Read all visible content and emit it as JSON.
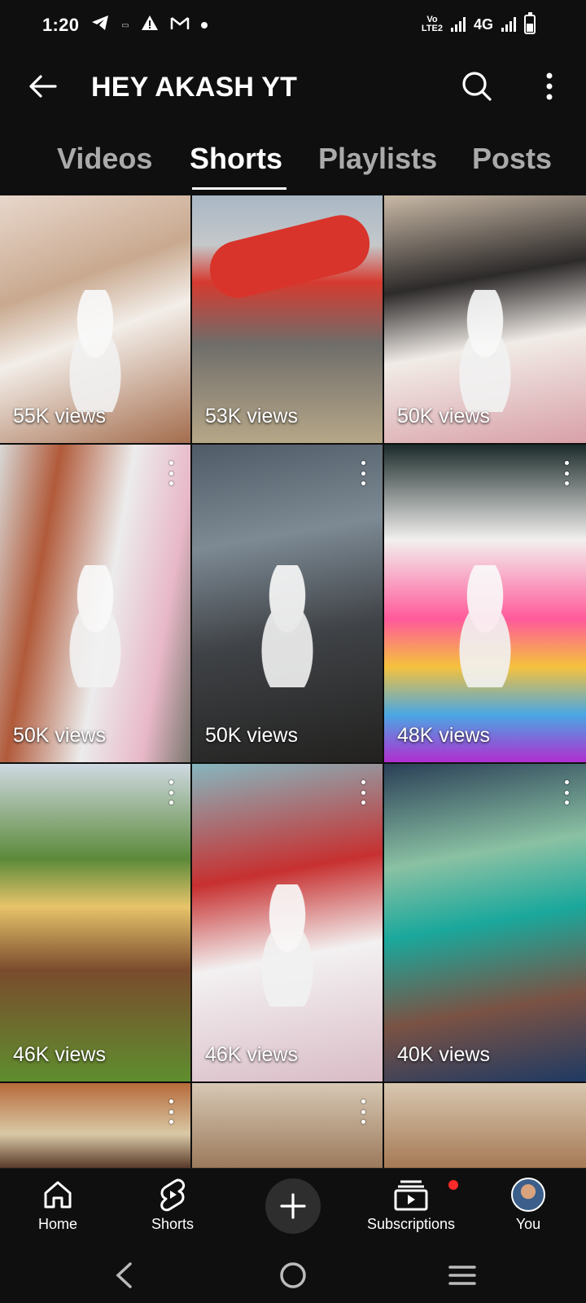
{
  "status_bar": {
    "time": "1:20",
    "network_label": "4G"
  },
  "header": {
    "channel_name": "HEY AKASH YT"
  },
  "tabs": [
    {
      "label": "Videos",
      "active": false
    },
    {
      "label": "Shorts",
      "active": true
    },
    {
      "label": "Playlists",
      "active": false
    },
    {
      "label": "Posts",
      "active": false
    }
  ],
  "shorts": [
    {
      "views": "55K views",
      "bg": "linear-gradient(160deg,#e8d7cc 0%,#c9a98f 35%,#f3eee9 55%,#a46d4d 100%)",
      "subject": "cat"
    },
    {
      "views": "53K views",
      "bg": "linear-gradient(180deg,#a9b7c4 0%,#c4c8ca 20%,#d63a2f 35%,#6f6d6a 60%,#b6a788 100%)",
      "subject": "plane"
    },
    {
      "views": "50K views",
      "bg": "linear-gradient(170deg,#c9b9a6 0%,#2d2a2a 35%,#f1ece7 60%,#d8a0a8 100%)",
      "subject": "cat"
    },
    {
      "views": "50K views",
      "bg": "linear-gradient(100deg,#d8d8d6 0%,#b15a3a 25%,#ececec 55%,#e8b8c8 80%,#7b776f 100%)",
      "subject": "cat"
    },
    {
      "views": "50K views",
      "bg": "linear-gradient(170deg,#4f5b66 0%,#7d8a94 30%,#3f4246 60%,#22211f 100%)",
      "subject": "cat"
    },
    {
      "views": "48K views",
      "bg": "linear-gradient(180deg,#1b2b2a 0%,#f2f0ee 30%,#ff5a9a 55%,#f5c23d 70%,#4aa7e3 85%,#b12ed1 100%)",
      "subject": "cat"
    },
    {
      "views": "46K views",
      "bg": "linear-gradient(180deg,#cfd9e2 0%,#5c8a3a 30%,#e7c46a 45%,#7a4b2d 65%,#5f8e2e 100%)",
      "subject": "kid"
    },
    {
      "views": "46K views",
      "bg": "linear-gradient(170deg,#86b6bf 0%,#c73030 35%,#f3f1f1 60%,#d9bcc6 100%)",
      "subject": "cat"
    },
    {
      "views": "40K views",
      "bg": "linear-gradient(170deg,#2a3f57 0%,#8ac1a3 30%,#1aa89c 50%,#7a5244 75%,#1f3a63 100%)",
      "subject": "people"
    },
    {
      "views": "",
      "bg": "linear-gradient(180deg,#b66a3a 0%,#d9c9a6 60%,#5a3a2a 100%)",
      "subject": "partial"
    },
    {
      "views": "",
      "bg": "linear-gradient(180deg,#d7c8b4 0%,#9c7a5c 100%)",
      "subject": "partial"
    },
    {
      "views": "",
      "bg": "linear-gradient(180deg,#d8c7b0 0%,#a67a55 100%)",
      "subject": "partial"
    }
  ],
  "bottom_nav": {
    "home": "Home",
    "shorts": "Shorts",
    "subscriptions": "Subscriptions",
    "you": "You"
  }
}
